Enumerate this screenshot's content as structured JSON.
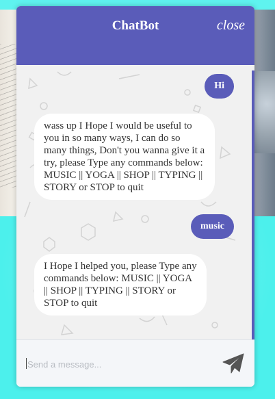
{
  "chatbot": {
    "title": "ChatBot",
    "close_label": "close",
    "messages": [
      {
        "from": "user",
        "text": "Hi"
      },
      {
        "from": "bot",
        "text": "wass up I Hope I would be useful to you in so many ways, I can do so many things, Don't you wanna give it a try, please Type any commands below: MUSIC || YOGA || SHOP || TYPING || STORY or STOP to quit"
      },
      {
        "from": "user",
        "text": "music"
      },
      {
        "from": "bot",
        "text": "I Hope I helped you, please Type any commands below: MUSIC || YOGA || SHOP || TYPING || STORY or STOP to quit"
      }
    ],
    "input": {
      "placeholder": "Send a message...",
      "value": ""
    },
    "send_icon": "paper-plane-icon"
  },
  "colors": {
    "accent": "#5a5cb9",
    "page_background": "#5ff3ef",
    "bubble_bot": "#ffffff"
  }
}
